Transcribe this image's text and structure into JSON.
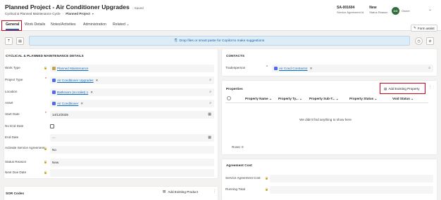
{
  "header": {
    "title": "Planned Project - Air Conditioner Upgrades",
    "saved_status": "- Saved",
    "entity_type": "Cyclical & Planned Maintenance Cycle",
    "separator": "·",
    "bpf_name": "Planned Project",
    "fields": [
      {
        "value": "SA-001604",
        "label": "Service Agreement Id"
      },
      {
        "value": "New",
        "label": "Status Reason"
      }
    ],
    "owner": {
      "initials": "CO",
      "name": "",
      "label": "Owner"
    }
  },
  "tabs": [
    {
      "label": "General",
      "active": true
    },
    {
      "label": "Work Details"
    },
    {
      "label": "Notes/Activities"
    },
    {
      "label": "Administration"
    },
    {
      "label": "Related"
    }
  ],
  "toolbar": {
    "form_assist_label": "Form assist",
    "dropzone_text": "Drop files or smart paste for Copilot to make suggestions"
  },
  "details": {
    "title": "CYCLICAL & PLANNED MAINTENANCE DETAILS",
    "fields": {
      "work_type": {
        "label": "Work Type",
        "value": "Planned Maintenance"
      },
      "project_type": {
        "label": "Project Type",
        "value": "Air Conditioner Upgrades"
      },
      "location": {
        "label": "Location",
        "value": "Bathroom (no toilet) 1"
      },
      "asset": {
        "label": "Asset",
        "value": "Air Conditioner"
      },
      "start_date": {
        "label": "Start Date",
        "value": "14/12/2025"
      },
      "no_end_date": {
        "label": "No End Date",
        "checked": false
      },
      "end_date": {
        "label": "End Date",
        "value": "---"
      },
      "activate_sa": {
        "label": "Activate Service Agreement",
        "value": "No"
      },
      "status_reason": {
        "label": "Status Reason",
        "value": "New"
      },
      "next_due_date": {
        "label": "Next Due Date",
        "value": ""
      }
    }
  },
  "contacts": {
    "title": "CONTACTS",
    "tradesperson": {
      "label": "Tradesperson",
      "value": "Air Cond Contractor"
    }
  },
  "properties": {
    "title": "Properties",
    "add_label": "Add Existing Property",
    "columns": [
      "Property Name",
      "Property Ty...",
      "Property Sub-T...",
      "Property Status",
      "Void Status"
    ],
    "empty_message": "We didn't find anything to show here",
    "rows_label": "Rows: 0"
  },
  "sor_codes": {
    "title": "SOR Codes",
    "add_label": "Add Existing Product"
  },
  "agreement_cost": {
    "title": "Agreement Cost",
    "fields": {
      "sa_cost": {
        "label": "Service Agreement Cost",
        "value": ""
      },
      "running_total": {
        "label": "Running Total",
        "value": ""
      }
    }
  },
  "colors": {
    "accent": "#0f6cbd",
    "highlight": "#d0001b",
    "dropzone": "#dcedf8"
  }
}
